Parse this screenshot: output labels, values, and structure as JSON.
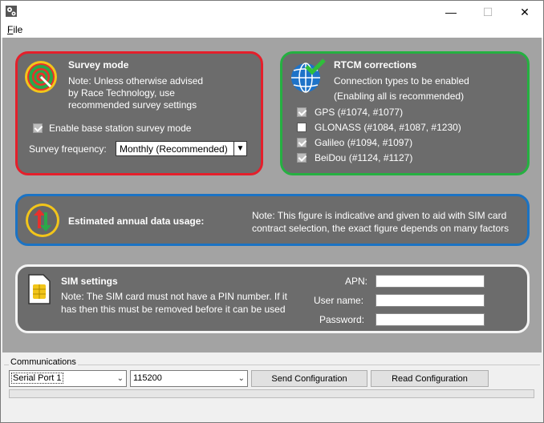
{
  "window": {
    "title": ""
  },
  "menu": {
    "file_accel": "F",
    "file_rest": "ile"
  },
  "survey": {
    "title": "Survey mode",
    "note": [
      "Note: Unless otherwise advised",
      "by Race Technology, use",
      "recommended survey settings"
    ],
    "enable_label": "Enable base station survey mode",
    "enable_checked": true,
    "frequency_label": "Survey frequency:",
    "frequency_value": "Monthly (Recommended)",
    "icon": "survey-target-icon"
  },
  "rtcm": {
    "title": "RTCM corrections",
    "note": [
      "Connection types to be enabled",
      "(Enabling all is recommended)"
    ],
    "icon": "globe-check-icon",
    "items": [
      {
        "label": "GPS (#1074, #1077)",
        "checked": true
      },
      {
        "label": "GLONASS (#1084, #1087, #1230)",
        "checked": false
      },
      {
        "label": "Galileo (#1094, #1097)",
        "checked": true
      },
      {
        "label": "BeiDou (#1124, #1127)",
        "checked": true
      }
    ]
  },
  "usage": {
    "title": "Estimated annual data usage:",
    "note": [
      "Note: This figure is indicative and given to aid with SIM card",
      "contract selection, the exact figure depends on many factors"
    ],
    "icon": "up-down-arrows-icon"
  },
  "sim": {
    "title": "SIM settings",
    "note": [
      "Note: The SIM card must not have a PIN number. If it",
      "has then this must be removed before it can be used"
    ],
    "icon": "sim-card-icon",
    "apn_label": "APN:",
    "apn_value": "",
    "user_label": "User name:",
    "user_value": "",
    "password_label": "Password:",
    "password_value": ""
  },
  "comms": {
    "group_label": "Communications",
    "port_value": "Serial Port 1",
    "baud_value": "115200",
    "send_label": "Send Configuration",
    "read_label": "Read Configuration",
    "progress": 0
  }
}
